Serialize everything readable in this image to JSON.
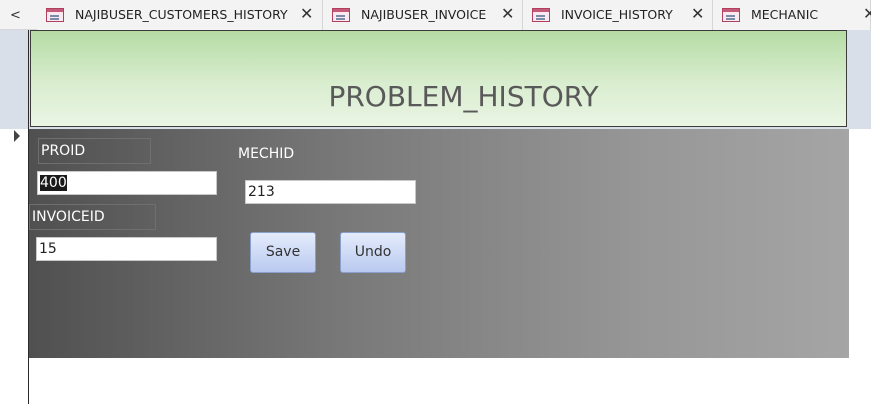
{
  "tabs": [
    {
      "label": "NAJIBUSER_CUSTOMERS_HISTORY",
      "close": "✕"
    },
    {
      "label": "NAJIBUSER_INVOICE",
      "close": "✕"
    },
    {
      "label": "INVOICE_HISTORY",
      "close": "✕"
    },
    {
      "label": "MECHANIC",
      "close": "✕"
    }
  ],
  "tab_nav_left": "<",
  "form": {
    "title": "PROBLEM_HISTORY",
    "fields": {
      "proid": {
        "label": "PROID",
        "value": "400"
      },
      "invoiceid": {
        "label": "INVOICEID",
        "value": "15"
      },
      "mechid": {
        "label": "MECHID",
        "value": "213"
      }
    },
    "buttons": {
      "save": "Save",
      "undo": "Undo"
    }
  },
  "colors": {
    "header_green": "#b5dca4",
    "button_blue": "#cfdbf6",
    "detail_dark": "#505050"
  },
  "icons": [
    "chevron-left-icon",
    "form-icon",
    "close-icon",
    "record-selector-arrow-icon"
  ]
}
